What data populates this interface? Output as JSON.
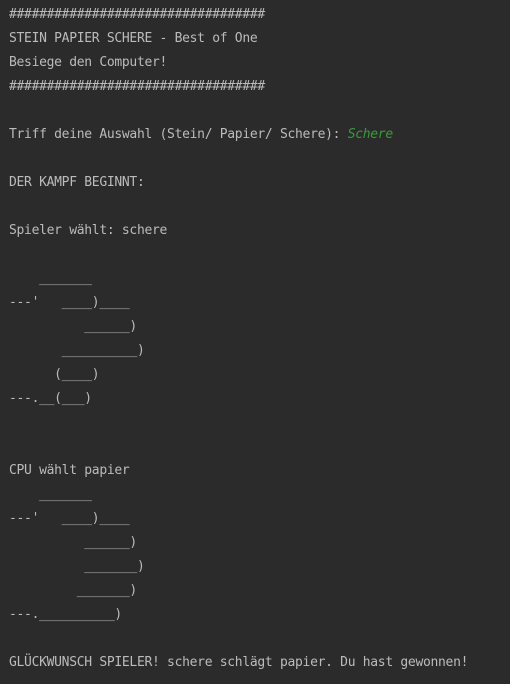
{
  "console": {
    "lines": [
      {
        "text": "##################################"
      },
      {
        "text": "STEIN PAPIER SCHERE - Best of One"
      },
      {
        "text": "Besiege den Computer!"
      },
      {
        "text": "##################################"
      },
      {
        "text": ""
      },
      {
        "text": "Triff deine Auswahl (Stein/ Papier/ Schere): ",
        "input": "Schere"
      },
      {
        "text": ""
      },
      {
        "text": "DER KAMPF BEGINNT:"
      },
      {
        "text": ""
      },
      {
        "text": "Spieler wählt: schere"
      },
      {
        "text": ""
      },
      {
        "text": "    _______"
      },
      {
        "text": "---'   ____)____"
      },
      {
        "text": "          ______)"
      },
      {
        "text": "       __________)"
      },
      {
        "text": "      (____)"
      },
      {
        "text": "---.__(___)"
      },
      {
        "text": ""
      },
      {
        "text": ""
      },
      {
        "text": "CPU wählt papier"
      },
      {
        "text": "    _______"
      },
      {
        "text": "---'   ____)____"
      },
      {
        "text": "          ______)"
      },
      {
        "text": "          _______)"
      },
      {
        "text": "         _______)"
      },
      {
        "text": "---.__________)"
      },
      {
        "text": ""
      },
      {
        "text": "GLÜCKWUNSCH SPIELER! schere schlägt papier. Du hast gewonnen!"
      }
    ]
  },
  "colors": {
    "background": "#2b2b2b",
    "output_text": "#bbbbbb",
    "user_input": "#3a9b39"
  }
}
